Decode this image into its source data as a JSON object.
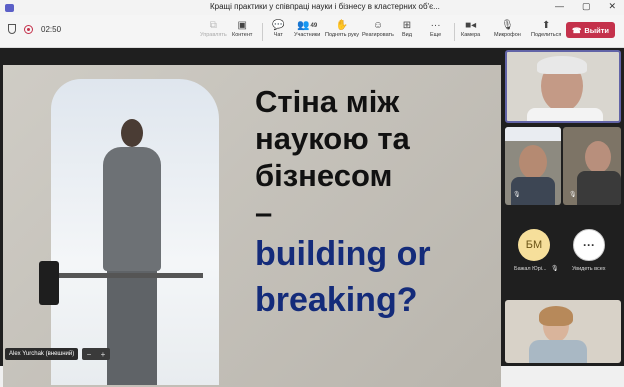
{
  "window": {
    "title": "Кращі практики у співпраці науки і бізнесу в кластерних об'є...",
    "controls": [
      "—",
      "▢",
      "✕"
    ]
  },
  "toolbar": {
    "timer": "02:50",
    "buttons": [
      {
        "label": "Управлять",
        "icon": "share-control-icon",
        "disabled": true
      },
      {
        "label": "Контент",
        "icon": "share-content-icon"
      },
      {
        "label": "Чат",
        "icon": "chat-icon"
      },
      {
        "label": "Участники",
        "icon": "people-icon",
        "count": "49"
      },
      {
        "label": "Поднять руку",
        "icon": "raise-hand-icon"
      },
      {
        "label": "Реагировать",
        "icon": "react-icon"
      },
      {
        "label": "Вид",
        "icon": "view-icon"
      },
      {
        "label": "Еще",
        "icon": "more-icon"
      },
      {
        "label": "Камера",
        "icon": "camera-icon"
      },
      {
        "label": "Микрофон",
        "icon": "mic-muted-icon"
      },
      {
        "label": "Поделиться",
        "icon": "share-icon"
      }
    ],
    "leave_label": "Выйти"
  },
  "slide": {
    "line1": "Стіна між",
    "line2": "наукою та",
    "line3": "бізнесом",
    "dash": "–",
    "line4": "building or",
    "line5": "breaking?"
  },
  "presenter": {
    "name": "Alex Yurchak (внешний)"
  },
  "zoom": {
    "minus": "−",
    "plus": "+"
  },
  "participants": {
    "avatar_initials": "БМ",
    "avatar_name": "Бажал Юрі...",
    "more_label": "Увидеть всех",
    "more_glyph": "···"
  },
  "colors": {
    "leave": "#c4314b",
    "accent": "#6264a7",
    "slide_english": "#142b7a"
  }
}
